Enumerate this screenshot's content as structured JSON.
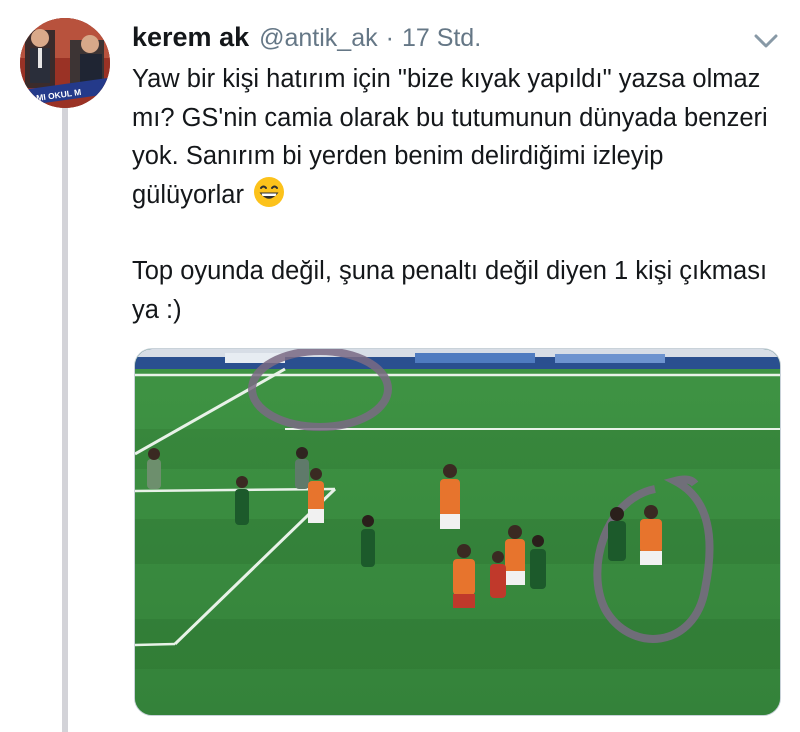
{
  "tweet": {
    "author_name": "kerem ak",
    "author_handle": "@antik_ak",
    "separator": "·",
    "timestamp": "17 Std.",
    "paragraph1": "Yaw bir kişi hatırım için \"bize kıyak yapıldı\" yazsa olmaz mı? GS'nin camia olarak bu tutumunun dünyada benzeri yok. Sanırım bi yerden benim delirdiğimi izleyip gülüyorlar",
    "emoji": "grinning-face-with-smiling-eyes",
    "paragraph2": "Top oyunda değil, şuna penaltı değil diyen 1 kişi çıkması ya :)"
  },
  "avatar": {
    "banner_text": "MI MI OKUL M"
  },
  "icons": {
    "chevron": "chevron-down-icon",
    "emoji": "grinning-emoji-icon"
  },
  "colors": {
    "text": "#14171a",
    "secondary": "#657786",
    "thread_line": "#d3d3d8",
    "pitch": "#3a8b3f",
    "annotation_circle": "#7a6a84"
  }
}
